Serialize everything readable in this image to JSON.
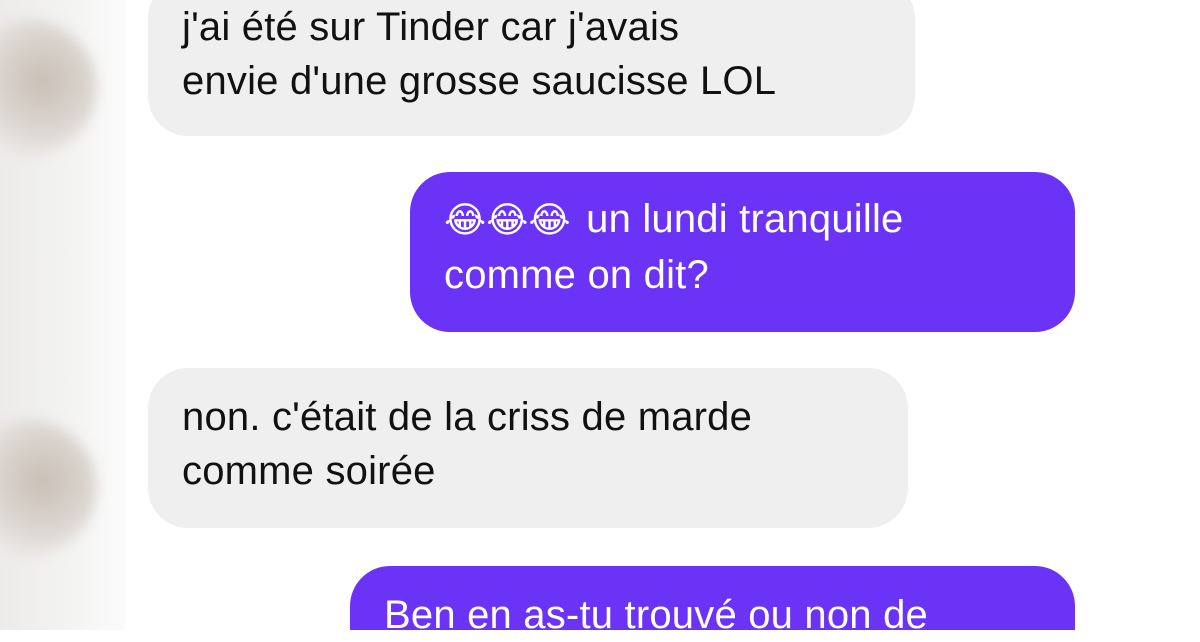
{
  "conversation": {
    "messages": [
      {
        "direction": "incoming",
        "lines": [
          "j'ai été sur Tinder car j'avais",
          "envie d'une grosse saucisse LOL"
        ]
      },
      {
        "direction": "outgoing",
        "emoji": "😂😂😂",
        "lines": [
          "un lundi tranquille",
          "comme on dit?"
        ]
      },
      {
        "direction": "incoming",
        "lines": [
          "non. c'était de la criss de marde",
          "comme soirée"
        ]
      },
      {
        "direction": "outgoing",
        "lines": [
          "Ben en as-tu trouvé ou non de"
        ]
      }
    ]
  },
  "colors": {
    "incoming_bubble": "#efefef",
    "outgoing_bubble": "#6a33f5",
    "incoming_text": "#111111",
    "outgoing_text": "#ffffff"
  }
}
